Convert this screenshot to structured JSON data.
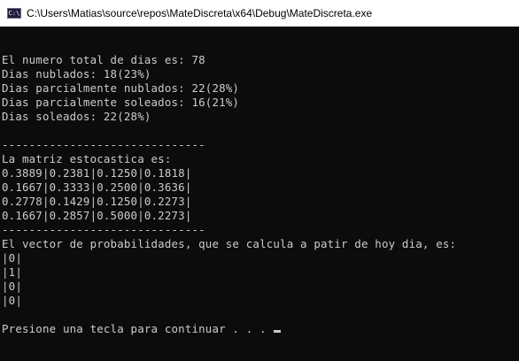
{
  "window": {
    "title": "C:\\Users\\Matias\\source\\repos\\MateDiscreta\\x64\\Debug\\MateDiscreta.exe",
    "icon": "console-app-icon",
    "icon_glyph": "C:\\"
  },
  "console": {
    "lines": [
      "",
      "El numero total de dias es: 78",
      "Dias nublados: 18(23%)",
      "Dias parcialmente nublados: 22(28%)",
      "Dias parcialmente soleados: 16(21%)",
      "Dias soleados: 22(28%)",
      "",
      "------------------------------",
      "La matriz estocastica es:",
      "0.3889|0.2381|0.1250|0.1818|",
      "0.1667|0.3333|0.2500|0.3636|",
      "0.2778|0.1429|0.1250|0.2273|",
      "0.1667|0.2857|0.5000|0.2273|",
      "------------------------------",
      "El vector de probabilidades, que se calcula a patir de hoy dia, es:",
      "|0|",
      "|1|",
      "|0|",
      "|0|",
      "",
      "Presione una tecla para continuar . . . "
    ]
  },
  "colors": {
    "background": "#0c0c0c",
    "text": "#cccccc",
    "titlebar": "#ffffff"
  }
}
